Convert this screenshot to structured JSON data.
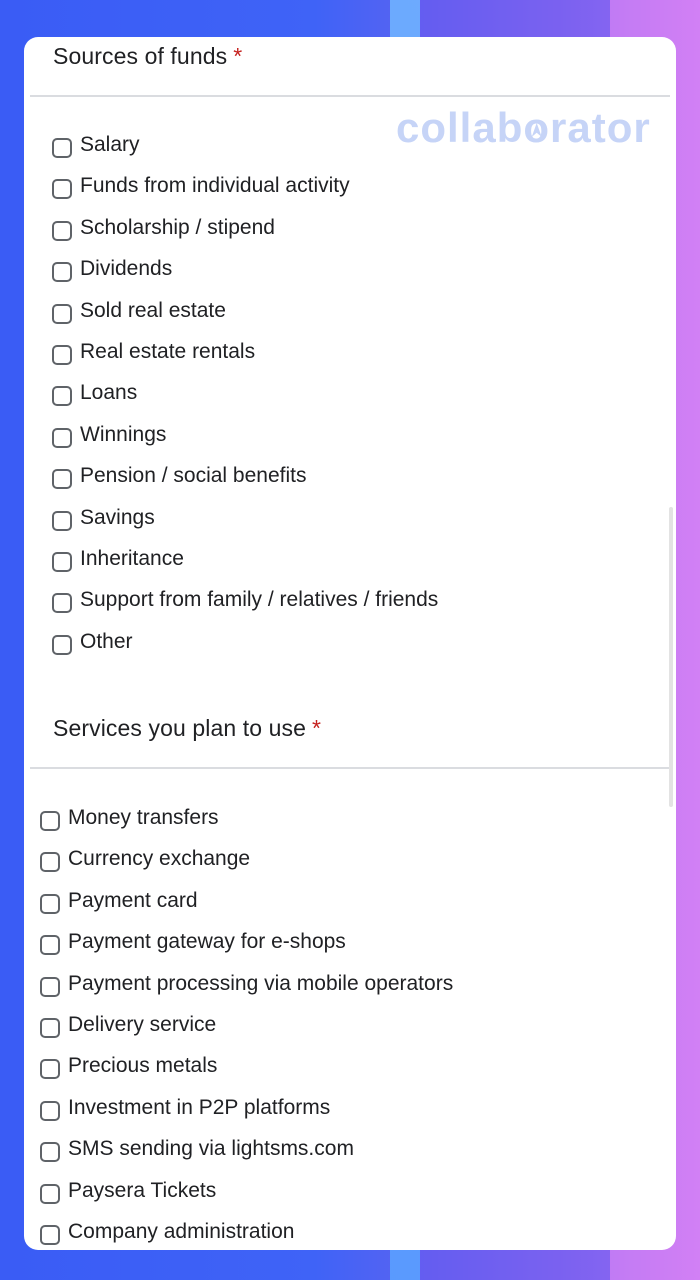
{
  "logo": {
    "text_before": "collab",
    "text_o": "o",
    "text_after": "rator"
  },
  "funds": {
    "title": "Sources of funds",
    "required_mark": "*",
    "options": [
      "Salary",
      "Funds from individual activity",
      "Scholarship / stipend",
      "Dividends",
      "Sold real estate",
      "Real estate rentals",
      "Loans",
      "Winnings",
      "Pension / social benefits",
      "Savings",
      "Inheritance",
      "Support from family / relatives / friends",
      "Other"
    ]
  },
  "services": {
    "title": "Services you plan to use",
    "required_mark": "*",
    "options": [
      "Money transfers",
      "Currency exchange",
      "Payment card",
      "Payment gateway for e-shops",
      "Payment processing via mobile operators",
      "Delivery service",
      "Precious metals",
      "Investment in P2P platforms",
      "SMS sending via lightsms.com",
      "Paysera Tickets",
      "Company administration"
    ]
  },
  "colors": {
    "required": "#c5221f",
    "text": "#202124",
    "divider": "#dadce0"
  }
}
